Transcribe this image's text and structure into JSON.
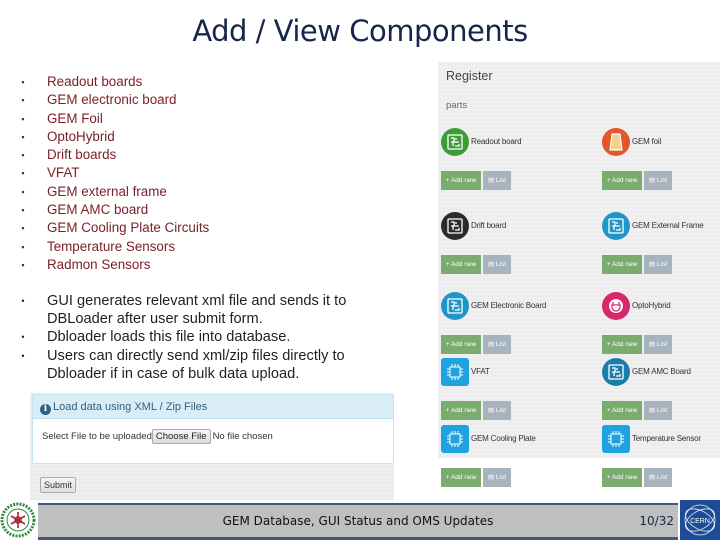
{
  "slide": {
    "title": "Add / View Components",
    "bullet_glyph": "▪",
    "components": [
      "Readout boards",
      "GEM electronic board",
      "GEM Foil",
      "OptoHybrid",
      "Drift boards",
      "VFAT",
      "GEM external frame",
      "GEM AMC board",
      "GEM Cooling Plate Circuits",
      "Temperature Sensors",
      "Radmon Sensors"
    ],
    "notes_glyph": "•",
    "notes": [
      "GUI generates relevant xml file and sends it to DBLoader after user submit form.",
      "Dbloader loads this file into database.",
      "Users can directly send xml/zip files directly to Dbloader if in case of bulk data upload."
    ]
  },
  "upload_panel": {
    "info_glyph": "i",
    "heading": "Load data using XML / Zip Files",
    "label": "Select File to be uploaded",
    "choose_button": "Choose File",
    "file_status": "No file chosen",
    "submit_button": "Submit"
  },
  "register": {
    "title": "Register",
    "subtitle": "parts",
    "add_label": "+ Add new",
    "list_label": "▤ List",
    "parts": [
      {
        "name": "Readout board",
        "icon": "circuit-icon",
        "color": "#3e9b3a"
      },
      {
        "name": "GEM foil",
        "icon": "foil-icon",
        "color": "#e2572a"
      },
      {
        "name": "Drift board",
        "icon": "circuit-icon",
        "color": "#2b2b2b"
      },
      {
        "name": "GEM External Frame",
        "icon": "circuit-icon",
        "color": "#1f95c9"
      },
      {
        "name": "GEM Electronic Board",
        "icon": "circuit-icon",
        "color": "#1f95c9"
      },
      {
        "name": "OptoHybrid",
        "icon": "plug-icon",
        "color": "#d8286d"
      },
      {
        "name": "VFAT",
        "icon": "chip-icon",
        "color": "#1ea2e0"
      },
      {
        "name": "GEM AMC Board",
        "icon": "circuit-icon",
        "color": "#1a7fa8"
      },
      {
        "name": "GEM Cooling Plate",
        "icon": "chip-icon",
        "color": "#1ea2e0"
      },
      {
        "name": "Temperature Sensor",
        "icon": "chip-icon",
        "color": "#1ea2e0"
      }
    ]
  },
  "footer": {
    "text": "GEM Database, GUI Status and OMS Updates",
    "page": "10/32",
    "right_logo_text": "CERN"
  }
}
